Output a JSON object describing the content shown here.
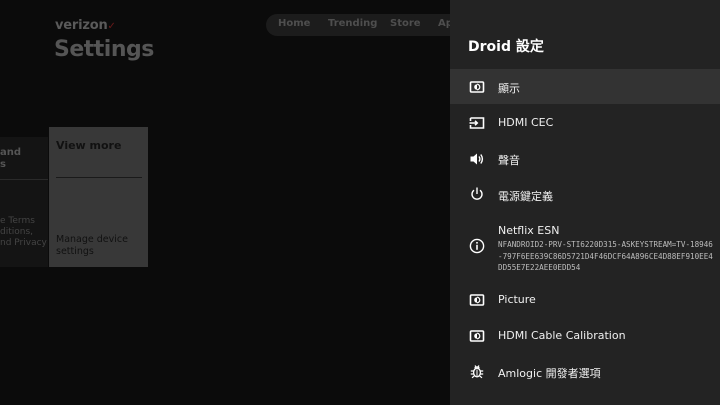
{
  "background": {
    "brand": "verizon",
    "title": "Settings",
    "nav": [
      "Home",
      "Trending",
      "Store",
      "Ap"
    ],
    "left_card": {
      "title": "and\ns",
      "text": "e Terms\nditions,\nnd Privacy"
    },
    "main_card": {
      "title": "View more",
      "text": "Manage device\nsettings"
    }
  },
  "panel": {
    "title": "Droid 設定",
    "items": [
      {
        "icon": "display-icon",
        "label": "顯示",
        "focused": true
      },
      {
        "icon": "hdmi-input-icon",
        "label": "HDMI CEC"
      },
      {
        "icon": "volume-icon",
        "label": "聲音"
      },
      {
        "icon": "power-icon",
        "label": "電源鍵定義"
      },
      {
        "icon": "info-icon",
        "label": "Netflix ESN",
        "desc": "NFANDROID2-PRV-STI6220D315-ASKEYSTREAM=TV-18946-797F6EE639C86D5721D4F46DCF64A896CE4D88EF910EE4DD55E7E22AEE0EDD54"
      },
      {
        "icon": "picture-icon",
        "label": "Picture"
      },
      {
        "icon": "calibration-icon",
        "label": "HDMI Cable Calibration"
      },
      {
        "icon": "bug-icon",
        "label": "Amlogic 開發者選項"
      }
    ]
  },
  "colors": {
    "panel_bg": "#232323",
    "focused_bg": "#333333",
    "screen_bg": "#000000"
  }
}
